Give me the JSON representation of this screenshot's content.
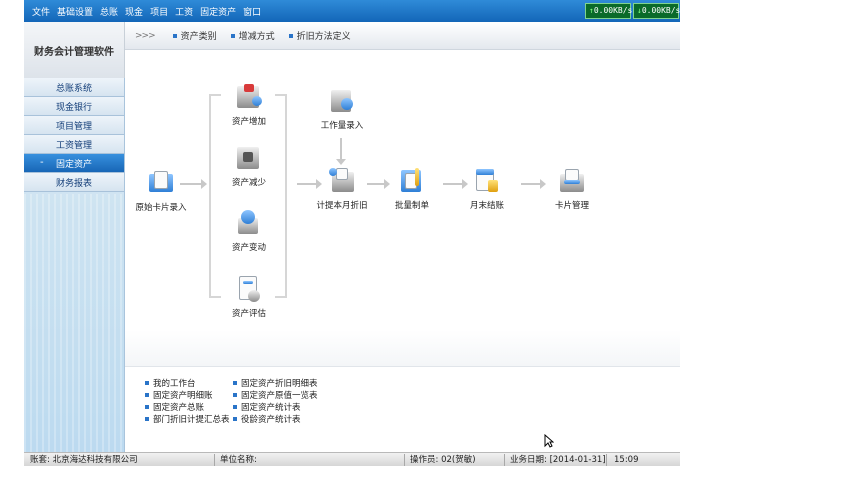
{
  "menu": {
    "items": [
      "文件",
      "基础设置",
      "总账",
      "现金",
      "项目",
      "工资",
      "固定资产",
      "窗口"
    ],
    "upload_speed": "0.00KB/s",
    "download_speed": "0.00KB/s"
  },
  "header": {
    "app_title": "财务会计管理软件",
    "toolbar_links": [
      "资产类别",
      "增减方式",
      "折旧方法定义"
    ]
  },
  "sidebar": {
    "items": [
      {
        "label": "总账系统",
        "active": false
      },
      {
        "label": "现金银行",
        "active": false
      },
      {
        "label": "项目管理",
        "active": false
      },
      {
        "label": "工资管理",
        "active": false
      },
      {
        "label": "固定资产",
        "active": true
      },
      {
        "label": "财务报表",
        "active": false
      }
    ]
  },
  "flow": {
    "card_entry": "原始卡片录入",
    "asset_add": "资产增加",
    "asset_reduce": "资产减少",
    "asset_change": "资产变动",
    "asset_evaluate": "资产评估",
    "workload_entry": "工作量录入",
    "depreciation": "计提本月折旧",
    "batch_voucher": "批量制单",
    "month_end": "月末结账",
    "card_manage": "卡片管理"
  },
  "quick_links": {
    "col1": [
      "我的工作台",
      "固定资产明细账",
      "固定资产总账",
      "部门折旧计提汇总表"
    ],
    "col2": [
      "固定资产折旧明细表",
      "固定资产原值一览表",
      "固定资产统计表",
      "役龄资产统计表"
    ]
  },
  "status": {
    "account_set": "账套: 北京海达科技有限公司",
    "unit_name": "单位名称:",
    "operator": "操作员: 02(贺敏)",
    "business_date": "业务日期: [2014-01-31]",
    "time": "15:09"
  },
  "colors": {
    "menubar": "#1f78c8",
    "sidebar_active": "#2a7ed0",
    "speed_box": "#0a6a2a"
  }
}
